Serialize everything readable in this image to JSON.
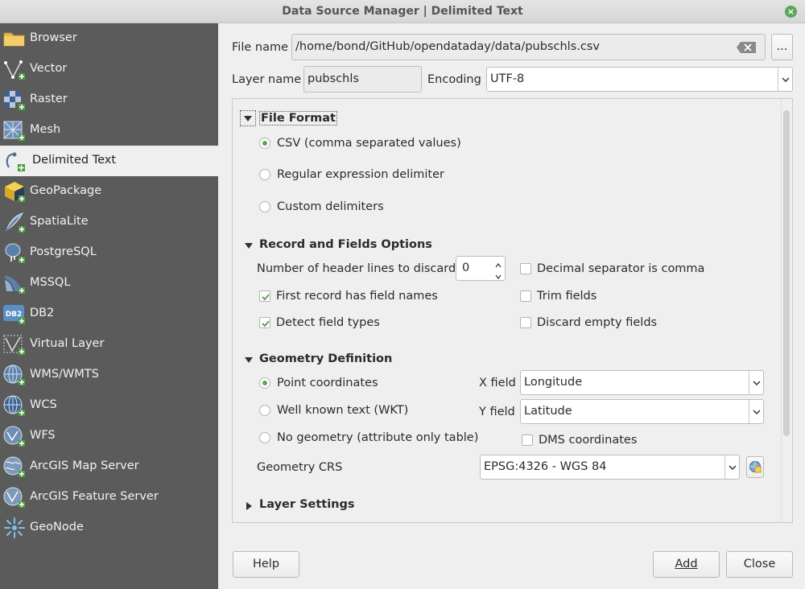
{
  "window": {
    "title": "Data Source Manager | Delimited Text"
  },
  "sidebar": {
    "items": [
      {
        "label": "Browser",
        "icon": "folder-icon"
      },
      {
        "label": "Vector",
        "icon": "vector-icon"
      },
      {
        "label": "Raster",
        "icon": "raster-icon"
      },
      {
        "label": "Mesh",
        "icon": "mesh-icon"
      },
      {
        "label": "Delimited Text",
        "icon": "delimited-text-icon",
        "active": true
      },
      {
        "label": "GeoPackage",
        "icon": "geopackage-icon"
      },
      {
        "label": "SpatiaLite",
        "icon": "spatialite-icon"
      },
      {
        "label": "PostgreSQL",
        "icon": "postgresql-icon"
      },
      {
        "label": "MSSQL",
        "icon": "mssql-icon"
      },
      {
        "label": "DB2",
        "icon": "db2-icon"
      },
      {
        "label": "Virtual Layer",
        "icon": "virtual-layer-icon"
      },
      {
        "label": "WMS/WMTS",
        "icon": "wms-icon"
      },
      {
        "label": "WCS",
        "icon": "wcs-icon"
      },
      {
        "label": "WFS",
        "icon": "wfs-icon"
      },
      {
        "label": "ArcGIS Map Server",
        "icon": "arcgis-map-icon"
      },
      {
        "label": "ArcGIS Feature Server",
        "icon": "arcgis-feature-icon"
      },
      {
        "label": "GeoNode",
        "icon": "geonode-icon"
      }
    ]
  },
  "file": {
    "label": "File name",
    "value": "/home/bond/GitHub/opendataday/data/pubschls.csv",
    "browse_label": "..."
  },
  "layer": {
    "label": "Layer name",
    "value": "pubschls"
  },
  "encoding": {
    "label": "Encoding",
    "value": "UTF-8"
  },
  "file_format": {
    "title": "File Format",
    "options": [
      {
        "label": "CSV (comma separated values)",
        "selected": true
      },
      {
        "label": "Regular expression delimiter",
        "selected": false
      },
      {
        "label": "Custom delimiters",
        "selected": false
      }
    ]
  },
  "record_options": {
    "title": "Record and Fields Options",
    "header_lines_label": "Number of header lines to discard",
    "header_lines_value": "0",
    "decimal_comma": {
      "label": "Decimal separator is comma",
      "checked": false
    },
    "first_record": {
      "label": "First record has field names",
      "checked": true
    },
    "trim_fields": {
      "label": "Trim fields",
      "checked": false
    },
    "detect_types": {
      "label": "Detect field types",
      "checked": true
    },
    "discard_empty": {
      "label": "Discard empty fields",
      "checked": false
    }
  },
  "geometry": {
    "title": "Geometry Definition",
    "options": [
      {
        "label": "Point coordinates",
        "selected": true
      },
      {
        "label": "Well known text (WKT)",
        "selected": false
      },
      {
        "label": "No geometry (attribute only table)",
        "selected": false
      }
    ],
    "x_label": "X field",
    "x_value": "Longitude",
    "y_label": "Y field",
    "y_value": "Latitude",
    "dms": {
      "label": "DMS coordinates",
      "checked": false
    },
    "crs_label": "Geometry CRS",
    "crs_value": "EPSG:4326 - WGS 84"
  },
  "layer_settings": {
    "title": "Layer Settings"
  },
  "buttons": {
    "help": "Help",
    "add": "Add",
    "close": "Close"
  },
  "colors": {
    "sidebar_bg": "#5b5b5b",
    "accent_green": "#62a05a"
  }
}
